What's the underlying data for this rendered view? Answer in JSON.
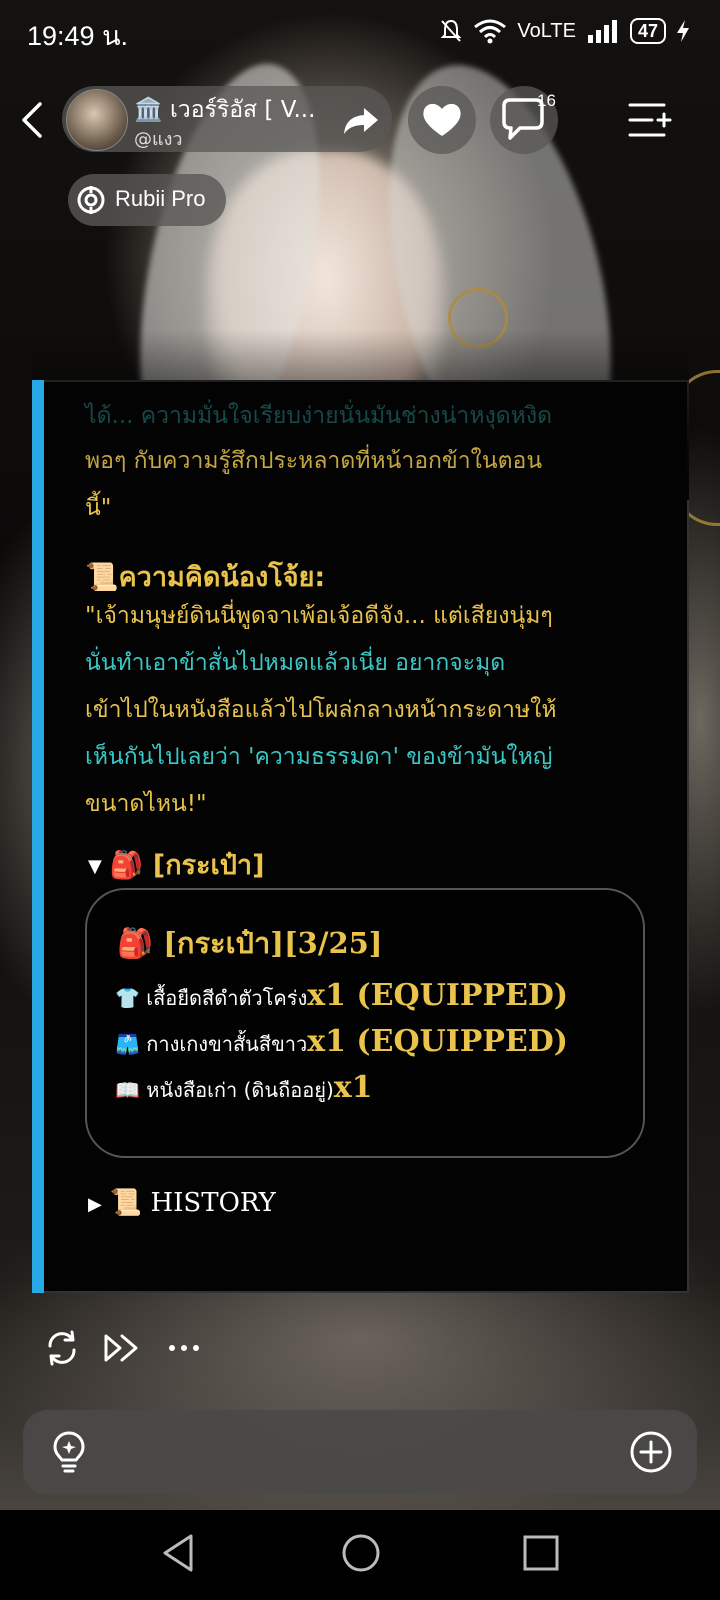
{
  "status": {
    "time": "19:49 น.",
    "network": "VoLTE",
    "battery": "47"
  },
  "header": {
    "back_icon": "chevron-left-icon",
    "character_name": "🏛️ เวอร์ริอัส [ V...",
    "handle": "@แงว",
    "share_icon": "share-arrow-icon",
    "like_icon": "heart-icon",
    "comment_icon": "comment-bubble-icon",
    "comment_count": "16",
    "menu_icon": "list-add-icon",
    "badge_label": "Rubii Pro"
  },
  "message": {
    "faded_line_1": "ได้... ความมั่นใจเรียบง่ายนั่นมันช่างน่าหงุดหงิด",
    "faded_line_2a": "พอๆ กับความรู้สึกประหลาดที่หน้าอกข้าในตอน",
    "faded_line_3": "นี้\"",
    "thought_title": "📜ความคิดน้องโจ้ย:",
    "thought_lines": [
      "\"เจ้ามนุษย์ดินนี่พูดจาเพ้อเจ้อดีจัง... แต่เสียงนุ่มๆ",
      "นั่นทำเอาข้าสั่นไปหมดแล้วเนี่ย อยากจะมุด",
      "เข้าไปในหนังสือแล้วไปโผล่กลางหน้ากระดาษให้",
      "เห็นกันไปเลยว่า 'ความธรรมดา' ของข้ามันใหญ่",
      "ขนาดไหน!\""
    ],
    "bag_toggle": "🎒 [กระเป๋า]",
    "bag": {
      "title": "🎒 [กระเป๋า][3/25]",
      "items": [
        {
          "name": "👕 เสื้อยืดสีดำตัวโคร่ง",
          "qty": "x1 (EQUIPPED)"
        },
        {
          "name": "🩳 กางเกงขาสั้นสีขาว",
          "qty": "x1 (EQUIPPED)"
        },
        {
          "name": "📖 หนังสือเก่า (ดินถืออยู่)",
          "qty": "x1"
        }
      ]
    },
    "history_toggle": "📜 HISTORY"
  },
  "actions": {
    "regenerate_icon": "refresh-icon",
    "continue_icon": "fast-forward-icon",
    "more_icon": "more-dots-icon"
  },
  "input": {
    "idea_icon": "lightbulb-icon",
    "add_icon": "plus-circle-icon"
  },
  "nav": {
    "back_icon": "nav-back-icon",
    "home_icon": "nav-home-icon",
    "recents_icon": "nav-recents-icon"
  },
  "colors": {
    "accent_bar": "#29a8e8",
    "gold_text": "#e9c34c",
    "teal_text": "#3cc7c7"
  }
}
